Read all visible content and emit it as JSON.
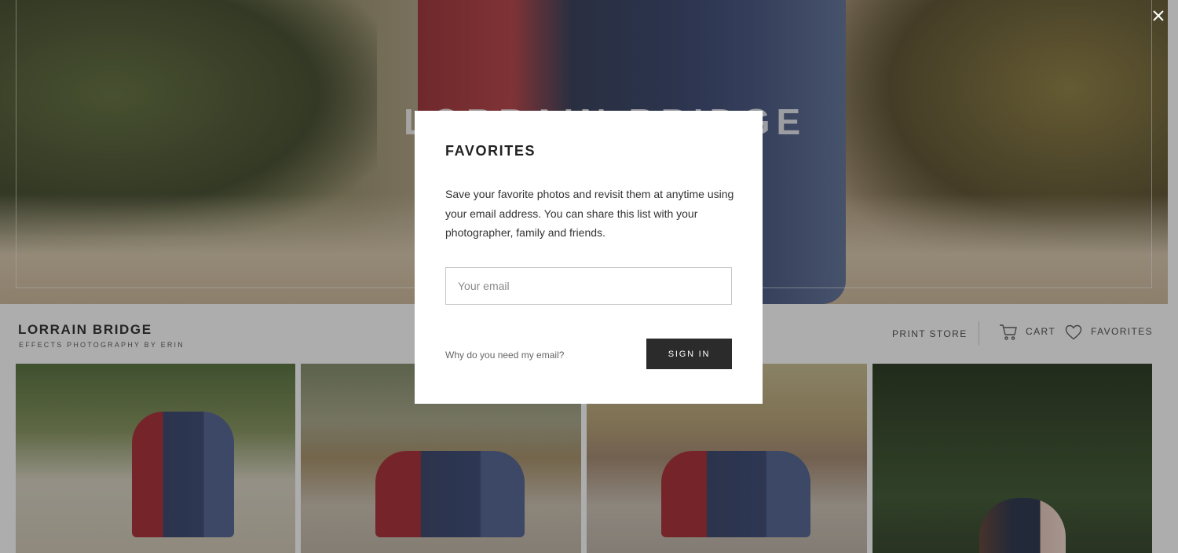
{
  "hero": {
    "title": "LORRAIN BRIDGE"
  },
  "gallery": {
    "title": "LORRAIN BRIDGE",
    "subtitle": "EFFECTS PHOTOGRAPHY BY ERIN"
  },
  "nav": {
    "print_store": "PRINT STORE",
    "cart": "CART",
    "favorites": "FAVORITES"
  },
  "modal": {
    "title": "FAVORITES",
    "body": "Save your favorite photos and revisit them at anytime using your email address. You can share this list with your photographer, family and friends.",
    "email_placeholder": "Your email",
    "why_link": "Why do you need my email?",
    "sign_in_label": "SIGN IN"
  },
  "icons": {
    "close": "close-icon",
    "cart": "cart-icon",
    "favorites": "heart-icon"
  },
  "colors": {
    "overlay": "#282828",
    "button_bg": "#2b2b2b",
    "text": "#222222"
  }
}
